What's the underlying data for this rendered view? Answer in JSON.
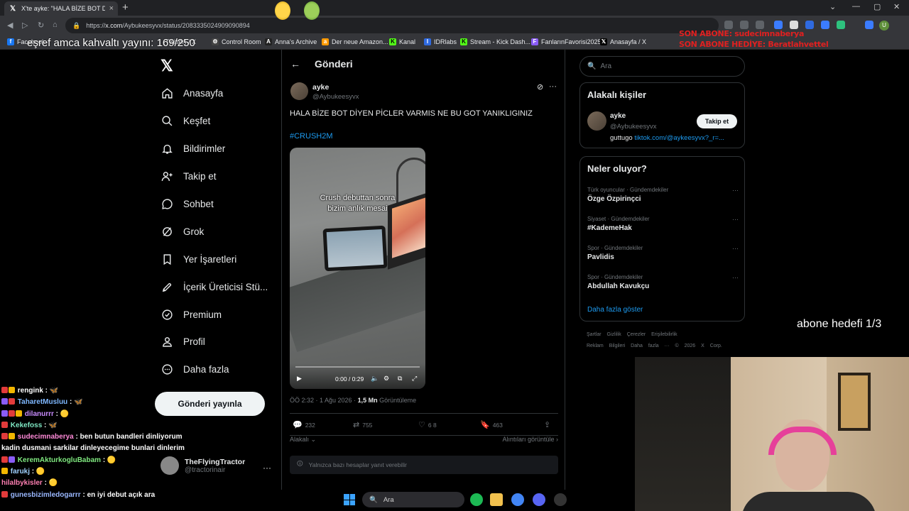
{
  "browser": {
    "tab_title": "X'te ayke: \"HALA BİZE BOT DİYEN",
    "url_prefix": "https://",
    "url_domain": "x.com",
    "url_path": "/Aybukeesyvx/status/2083335024909090894",
    "bookmarks": [
      "Facebook",
      "...",
      "(Twitter) / X",
      "Control Room",
      "Anna's Archive",
      "Der neue Amazon...",
      "Kanal",
      "IDRlabs",
      "Stream - Kick Dash...",
      "FanlarınFavorisi2025",
      "Anasayfa / X"
    ]
  },
  "overlays": {
    "top_text": "eşref amca kahvaltı yayını: 169/250",
    "son_abone": "SON ABONE: sudecimnaberya",
    "son_abone_hediye": "SON ABONE HEDİYE: Beratlahvettel",
    "abone_hedefi": "abone hedefi 1/3"
  },
  "nav": {
    "items": [
      {
        "label": "Anasayfa",
        "icon": "home-icon"
      },
      {
        "label": "Keşfet",
        "icon": "search-icon"
      },
      {
        "label": "Bildirimler",
        "icon": "bell-icon"
      },
      {
        "label": "Takip et",
        "icon": "person-plus-icon"
      },
      {
        "label": "Sohbet",
        "icon": "chat-icon"
      },
      {
        "label": "Grok",
        "icon": "grok-icon"
      },
      {
        "label": "Yer İşaretleri",
        "icon": "bookmark-icon"
      },
      {
        "label": "İçerik Üreticisi Stü...",
        "icon": "rocket-icon"
      },
      {
        "label": "Premium",
        "icon": "premium-icon"
      },
      {
        "label": "Profil",
        "icon": "profile-icon"
      },
      {
        "label": "Daha fazla",
        "icon": "more-icon"
      }
    ],
    "post_button": "Gönderi yayınla",
    "account_name": "TheFlyingTractor",
    "account_handle": "@tractorinair"
  },
  "tweet": {
    "header_title": "Gönderi",
    "author_name": "ayke",
    "author_handle": "@Aybukeesyvx",
    "text": "HALA BİZE BOT DİYEN PİCLER VARMIS NE BU GOT YANIKLIGINIZ",
    "hashtag": "#CRUSH2M",
    "video_caption_line1": "Crush debuttan sonra",
    "video_caption_line2": "bizim anlık mesai",
    "video_time": "0:00 / 0:29",
    "meta_time": "ÖÖ 2:32 · 1 Ağu 2026 · ",
    "views": "1,5 Mn",
    "views_label": " Görüntüleme",
    "replies": "232",
    "retweets": "755",
    "likes": "6 8",
    "bookmarks": "463",
    "sort_label": "Alakalı",
    "quotes_label": "Alıntıları görüntüle",
    "reply_restriction": "Yalnızca bazı hesaplar yanıt verebilir"
  },
  "right": {
    "search_placeholder": "Ara",
    "related_title": "Alakalı kişiler",
    "related_name": "ayke",
    "related_handle": "@Aybukeesyvx",
    "follow_label": "Takip et",
    "related_bio": "guttugo ",
    "related_link": "tiktok.com/@aykeesyvx?_r=...",
    "trends_title": "Neler oluyor?",
    "trends": [
      {
        "category": "Türk oyuncular · Gündemdekiler",
        "name": "Özge Özpirinçci"
      },
      {
        "category": "Siyaset · Gündemdekiler",
        "name": "#KademeHak"
      },
      {
        "category": "Spor · Gündemdekiler",
        "name": "Pavlidis"
      },
      {
        "category": "Spor · Gündemdekiler",
        "name": "Abdullah Kavukçu"
      }
    ],
    "show_more": "Daha fazla göster",
    "footer_line1": "Şartlar Gizlilik Çerezler Erişilebilirlik",
    "footer_line2": "Reklam Bilgileri Daha fazla ··· © 2026 X Corp."
  },
  "chat": [
    {
      "user": "rengink",
      "color": "#ffffff",
      "msg": " 🦋"
    },
    {
      "user": "TaharetMusluu",
      "color": "#7fb8ff",
      "msg": " 🦋"
    },
    {
      "user": "dilanurrr",
      "color": "#c98cff",
      "msg": " 🟡"
    },
    {
      "user": "Kekefoss",
      "color": "#7fe8c4",
      "msg": " 🦋"
    },
    {
      "user": "sudecimnaberya",
      "color": "#ff8ad8",
      "msg": " ben butun bandleri dinliyorum"
    },
    {
      "user": "",
      "color": "#ffffff",
      "msg": "kadin dusmani sarkilar dinleyecegime bunlari dinlerim"
    },
    {
      "user": "KeremAkturkogluBabam",
      "color": "#7fe87f",
      "msg": " 🟡"
    },
    {
      "user": "farukj",
      "color": "#9fd0ff",
      "msg": " 🟡"
    },
    {
      "user": "hilalbykisler",
      "color": "#ff7fb2",
      "msg": " 🟡"
    },
    {
      "user": "gunesbizimledogarrr",
      "color": "#9ab8ff",
      "msg": " en iyi debut açık ara"
    }
  ],
  "taskbar": {
    "search_placeholder": "Ara"
  },
  "colors": {
    "accent": "#1d9bf0",
    "background": "#000000",
    "border": "#2f3336",
    "muted": "#71767b"
  }
}
